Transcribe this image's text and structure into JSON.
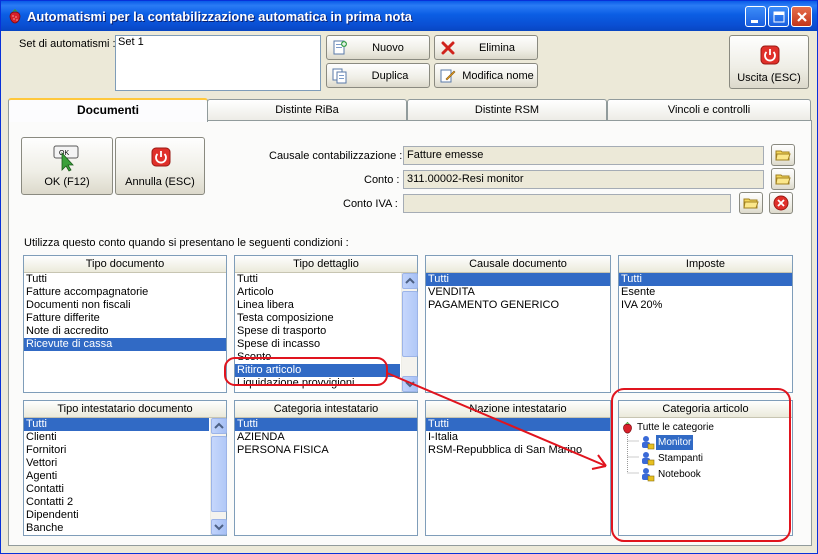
{
  "window": {
    "title": "Automatismi per la contabilizzazione automatica in prima nota",
    "app_icon": "strawberry-icon"
  },
  "top": {
    "set_label": "Set di automatismi :",
    "set_items": [
      "Set 1"
    ],
    "buttons": {
      "nuovo": "Nuovo",
      "elimina": "Elimina",
      "duplica": "Duplica",
      "modifica": "Modifica nome",
      "uscita": "Uscita (ESC)"
    }
  },
  "tabs": [
    "Documenti",
    "Distinte RiBa",
    "Distinte RSM",
    "Vincoli e controlli"
  ],
  "panel": {
    "ok_label": "OK (F12)",
    "annulla_label": "Annulla (ESC)",
    "causale_label": "Causale contabilizzazione :",
    "causale_value": "Fatture emesse",
    "conto_label": "Conto :",
    "conto_value": "311.00002-Resi monitor",
    "conto_iva_label": "Conto IVA :",
    "conto_iva_value": "",
    "conditions_text": "Utilizza questo conto quando si presentano le seguenti condizioni :"
  },
  "groups": {
    "tipo_documento": {
      "title": "Tipo documento",
      "items": [
        "Tutti",
        "Fatture accompagnatorie",
        "Documenti non fiscali",
        "Fatture differite",
        "Note di accredito",
        "Ricevute di cassa"
      ],
      "selected": 5
    },
    "tipo_dettaglio": {
      "title": "Tipo dettaglio",
      "items": [
        "Tutti",
        "Articolo",
        "Linea libera",
        "Testa composizione",
        "Spese di trasporto",
        "Spese di incasso",
        "Sconto",
        "Ritiro articolo",
        "Liquidazione provvigioni"
      ],
      "selected": 7
    },
    "causale_documento": {
      "title": "Causale documento",
      "items": [
        "Tutti",
        "VENDITA",
        "PAGAMENTO GENERICO"
      ],
      "selected": 0
    },
    "imposte": {
      "title": "Imposte",
      "items": [
        "Tutti",
        "Esente",
        "IVA 20%"
      ],
      "selected": 0
    },
    "tipo_intestatario": {
      "title": "Tipo intestatario documento",
      "items": [
        "Tutti",
        "Clienti",
        "Fornitori",
        "Vettori",
        "Agenti",
        "Contatti",
        "Contatti 2",
        "Dipendenti",
        "Banche"
      ],
      "selected": 0
    },
    "categoria_intestatario": {
      "title": "Categoria intestatario",
      "items": [
        "Tutti",
        "AZIENDA",
        "PERSONA FISICA"
      ],
      "selected": 0
    },
    "nazione_intestatario": {
      "title": "Nazione intestatario",
      "items": [
        "Tutti",
        "I-Italia",
        "RSM-Repubblica di San Marino"
      ],
      "selected": 0
    },
    "categoria_articolo": {
      "title": "Categoria articolo",
      "root": "Tutte le categorie",
      "children": [
        "Monitor",
        "Stampanti",
        "Notebook"
      ],
      "selected": 0
    }
  },
  "colors": {
    "selection": "#316ac5",
    "annotation": "#e0141e",
    "titlebar": "#0a5ce8"
  }
}
